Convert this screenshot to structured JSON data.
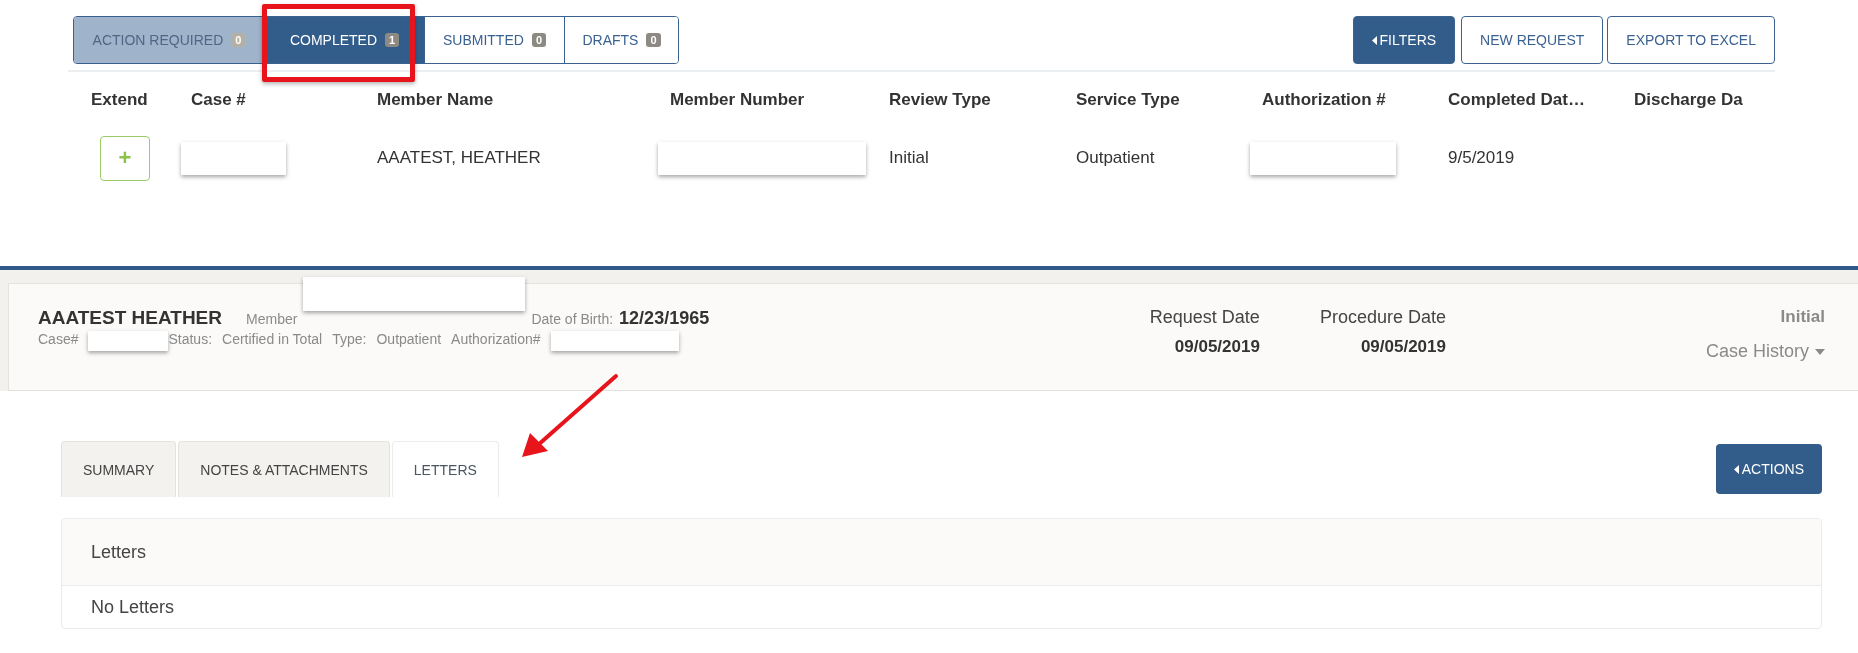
{
  "queue_tabs": [
    {
      "label": "ACTION REQUIRED",
      "count": "0",
      "selected": false,
      "disabled": true
    },
    {
      "label": "COMPLETED",
      "count": "1",
      "selected": true,
      "disabled": false
    },
    {
      "label": "SUBMITTED",
      "count": "0",
      "selected": false,
      "disabled": false
    },
    {
      "label": "DRAFTS",
      "count": "0",
      "selected": false,
      "disabled": false
    }
  ],
  "toolbar_buttons": [
    {
      "label": "FILTERS",
      "kind": "primary"
    },
    {
      "label": "NEW REQUEST",
      "kind": "outline"
    },
    {
      "label": "EXPORT TO EXCEL",
      "kind": "outline"
    }
  ],
  "table": {
    "columns": [
      "Extend",
      "Case #",
      "Member Name",
      "Member Number",
      "Review Type",
      "Service Type",
      "Authorization #",
      "Completed Dat…",
      "Discharge Da"
    ],
    "rows": [
      {
        "cells": [
          {
            "kind": "add",
            "text": "+"
          },
          {
            "kind": "redacted"
          },
          {
            "kind": "text",
            "text": "AAATEST, HEATHER"
          },
          {
            "kind": "redacted"
          },
          {
            "kind": "text",
            "text": "Initial"
          },
          {
            "kind": "text",
            "text": "Outpatient"
          },
          {
            "kind": "redacted"
          },
          {
            "kind": "text",
            "text": "9/5/2019"
          }
        ]
      }
    ]
  },
  "case_header": {
    "name": "AAATEST HEATHER",
    "line1": [
      {
        "kind": "label",
        "text": "Member"
      },
      {
        "kind": "redacted"
      },
      {
        "kind": "label",
        "text": "Date of Birth:"
      },
      {
        "kind": "value",
        "text": "12/23/1965"
      }
    ],
    "line2": [
      {
        "kind": "label",
        "text": "Case#"
      },
      {
        "kind": "redacted"
      },
      {
        "kind": "label",
        "text": "Status:"
      },
      {
        "kind": "label",
        "text": "Certified in Total"
      },
      {
        "kind": "label",
        "text": "Type:"
      },
      {
        "kind": "label",
        "text": "Outpatient"
      },
      {
        "kind": "label",
        "text": "Authorization#"
      },
      {
        "kind": "redacted"
      }
    ],
    "dates": [
      {
        "label": "Request Date",
        "value": "09/05/2019"
      },
      {
        "label": "Procedure Date",
        "value": "09/05/2019"
      }
    ],
    "review_type": "Initial",
    "case_history": "Case History"
  },
  "detail_tabs": [
    {
      "label": "SUMMARY",
      "selected": false
    },
    {
      "label": "NOTES & ATTACHMENTS",
      "selected": false
    },
    {
      "label": "LETTERS",
      "selected": true
    }
  ],
  "actions_button": "ACTIONS",
  "letters_panel": {
    "title": "Letters",
    "empty_text": "No Letters"
  }
}
